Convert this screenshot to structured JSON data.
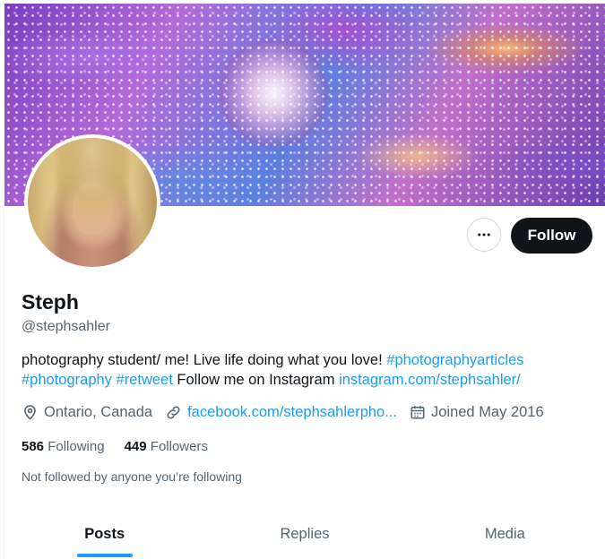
{
  "profile": {
    "name": "Steph",
    "handle": "@stephsahler",
    "bio": {
      "text": "photography student/ me! Live life doing what you love! ",
      "hashtag1": "#photographyarticles",
      "hashtag2": "#photography",
      "hashtag3": "#retweet",
      "text2": " Follow me on Instagram ",
      "instagram_link": "instagram.com/stephsahler/"
    },
    "location": "Ontario, Canada",
    "website": "facebook.com/stephsahlerpho...",
    "joined": "Joined May 2016",
    "following_count": "586",
    "following_label": "Following",
    "followers_count": "449",
    "followers_label": "Followers",
    "not_followed_text": "Not followed by anyone you’re following"
  },
  "actions": {
    "follow_label": "Follow",
    "more_icon": "more-icon"
  },
  "tabs": [
    {
      "label": "Posts",
      "active": true
    },
    {
      "label": "Replies",
      "active": false
    },
    {
      "label": "Media",
      "active": false
    }
  ],
  "colors": {
    "accent": "#1d9bf0",
    "text": "#0f1419",
    "secondary": "#536471"
  }
}
